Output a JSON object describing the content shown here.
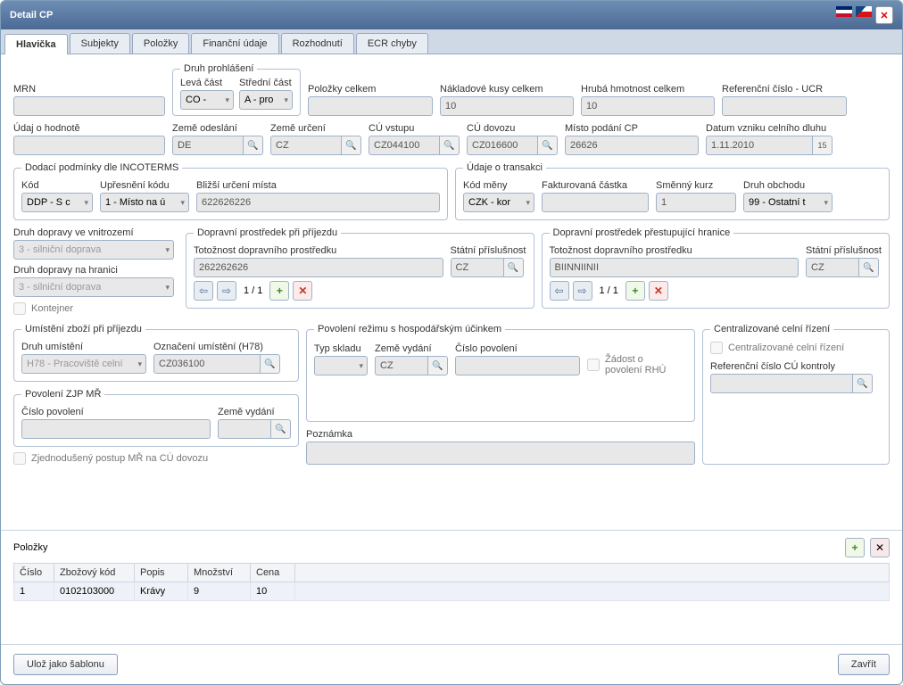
{
  "window": {
    "title": "Detail CP"
  },
  "tabs": [
    "Hlavička",
    "Subjekty",
    "Položky",
    "Finanční údaje",
    "Rozhodnutí",
    "ECR chyby"
  ],
  "row1": {
    "mrn_label": "MRN",
    "mrn": "",
    "druh_prohlaseni_legend": "Druh prohlášení",
    "leva_label": "Levá část",
    "leva": "CO -",
    "stredni_label": "Střední část",
    "stredni": "A - pro",
    "polozky_label": "Položky celkem",
    "polozky": "",
    "kusy_label": "Nákladové kusy celkem",
    "kusy": "10",
    "hmotnost_label": "Hrubá hmotnost celkem",
    "hmotnost": "10",
    "ucr_label": "Referenční číslo - UCR",
    "ucr": ""
  },
  "row2": {
    "hodnota_label": "Údaj o hodnotě",
    "hodnota": "",
    "odeslani_label": "Země odeslání",
    "odeslani": "DE",
    "urceni_label": "Země určení",
    "urceni": "CZ",
    "vstup_label": "CÚ vstupu",
    "vstup": "CZ044100",
    "dovoz_label": "CÚ dovozu",
    "dovoz": "CZ016600",
    "misto_label": "Místo podání CP",
    "misto": "26626",
    "datum_label": "Datum vzniku celního dluhu",
    "datum": "1.11.2010",
    "datum_day": "15"
  },
  "incoterms": {
    "legend": "Dodací podmínky dle INCOTERMS",
    "kod_label": "Kód",
    "kod": "DDP - S c",
    "upresneni_label": "Upřesnění kódu",
    "upresneni": "1 - Místo na ú",
    "mista_label": "Bližší určení místa",
    "mista": "622626226"
  },
  "transakce": {
    "legend": "Údaje o transakci",
    "mena_label": "Kód měny",
    "mena": "CZK - kor",
    "faktura_label": "Fakturovaná částka",
    "faktura": "",
    "kurz_label": "Směnný kurz",
    "kurz": "1",
    "obchod_label": "Druh obchodu",
    "obchod": "99 - Ostatní t"
  },
  "doprava": {
    "vnitro_label": "Druh dopravy ve vnitrozemí",
    "vnitro": "3 - silniční doprava",
    "hranice_label": "Druh dopravy na hranici",
    "hranice": "3 - silniční doprava",
    "kontejner_label": "Kontejner"
  },
  "prijezd": {
    "legend": "Dopravní prostředek při příjezdu",
    "totoz_label": "Totožnost dopravního prostředku",
    "totoz": "262262626",
    "stat_label": "Státní příslušnost",
    "stat": "CZ",
    "pager": "1 / 1"
  },
  "prestup": {
    "legend": "Dopravní prostředek přestupující hranice",
    "totoz_label": "Totožnost dopravního prostředku",
    "totoz": "BIINNIINII",
    "stat_label": "Státní příslušnost",
    "stat": "CZ",
    "pager": "1 / 1"
  },
  "umisteni": {
    "legend": "Umístění zboží při příjezdu",
    "druh_label": "Druh umístění",
    "druh": "H78 - Pracoviště celní",
    "oznaceni_label": "Označení umístění (H78)",
    "oznaceni": "CZ036100"
  },
  "zjp": {
    "legend": "Povolení ZJP MŘ",
    "cislo_label": "Číslo povolení",
    "cislo": "",
    "zeme_label": "Země vydání",
    "zeme": "",
    "zpmr_label": "Zjednodušený postup MŘ na CÚ dovozu"
  },
  "rezim": {
    "legend": "Povolení režimu s hospodářským účinkem",
    "typ_label": "Typ skladu",
    "typ": "",
    "zeme_label": "Země vydání",
    "zeme": "CZ",
    "cislo_label": "Číslo povolení",
    "cislo": "",
    "zadost_label": "Žádost o povolení RHÚ"
  },
  "ccr": {
    "legend": "Centralizované celní řízení",
    "check_label": "Centralizované celní řízení",
    "ref_label": "Referenční číslo CÚ kontroly",
    "ref": ""
  },
  "poznamka_label": "Poznámka",
  "poznamka": "",
  "items": {
    "title": "Položky",
    "headers": {
      "cislo": "Číslo",
      "kod": "Zbožový kód",
      "popis": "Popis",
      "mnozstvi": "Množství",
      "cena": "Cena"
    },
    "rows": [
      {
        "cislo": "1",
        "kod": "0102103000",
        "popis": "Krávy",
        "mnozstvi": "9",
        "cena": "10"
      }
    ]
  },
  "footer": {
    "save": "Ulož jako šablonu",
    "close": "Zavřít"
  }
}
